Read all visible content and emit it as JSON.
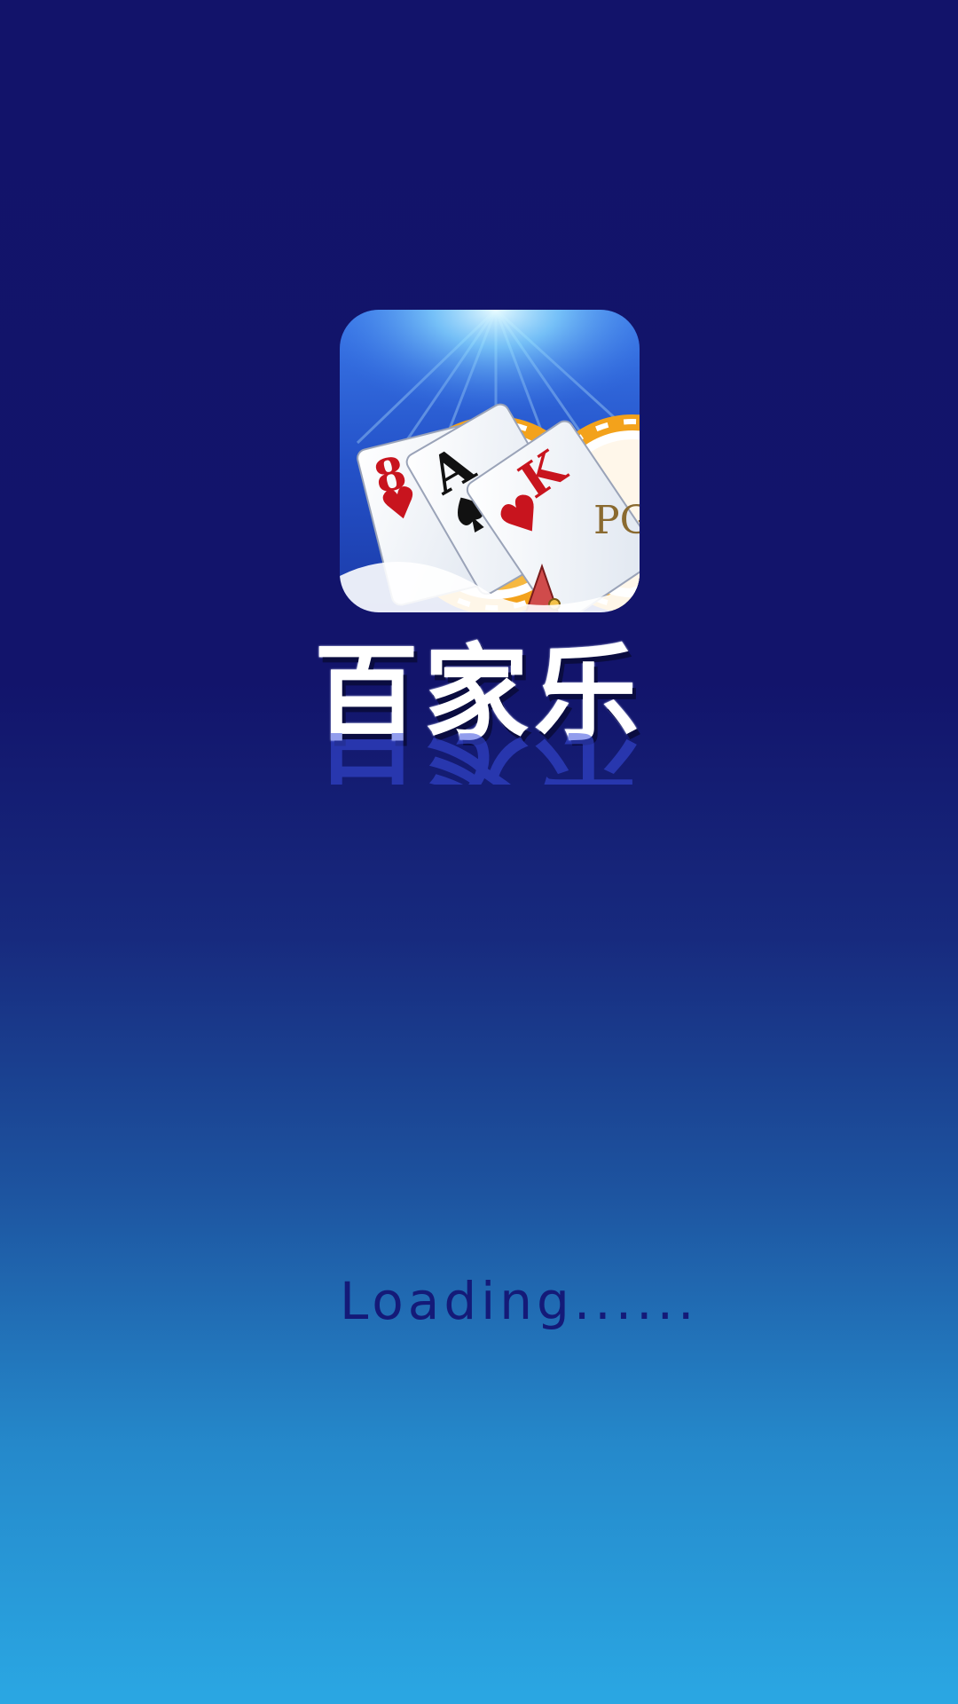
{
  "splash": {
    "app_title": "百家乐",
    "loading_text": "Loading......"
  },
  "app_icon": {
    "icon_name": "playing-cards-and-chips-icon",
    "cards": [
      {
        "rank": "8",
        "suit": "heart"
      },
      {
        "rank": "A",
        "suit": "spade"
      },
      {
        "rank": "K",
        "suit": "heart"
      }
    ]
  },
  "colors": {
    "background_top": "#12136a",
    "background_bottom": "#2aa7e3",
    "title_text": "#ffffff",
    "loading_text": "#141a78",
    "chip_gold": "#f3a21b",
    "card_red": "#c8141e"
  }
}
